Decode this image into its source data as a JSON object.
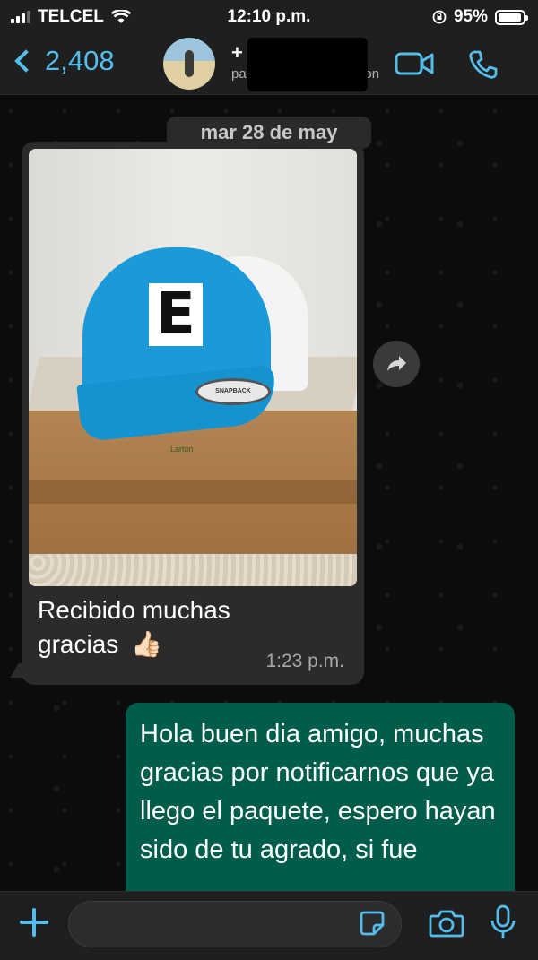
{
  "status_bar": {
    "carrier": "TELCEL",
    "time": "12:10 p.m.",
    "battery_percent": "95%",
    "battery_level": 0.95
  },
  "header": {
    "back_count": "2,408",
    "contact_name": "+",
    "contact_status_left": "pai",
    "contact_status_right": "on"
  },
  "chat": {
    "date_separator": "mar 28 de may",
    "messages": [
      {
        "direction": "incoming",
        "has_image": true,
        "image_letter": "E",
        "image_patch_text": "SNAPBACK",
        "image_box_text": "Larton",
        "text": "Recibido muchas gracias",
        "emoji": "👍🏻",
        "time": "1:23 p.m."
      },
      {
        "direction": "outgoing",
        "text": "Hola buen dia amigo, muchas gracias por notificarnos que ya llego el paquete, espero hayan sido de tu agrado, si fue"
      }
    ]
  },
  "input": {
    "placeholder": "",
    "value": ""
  },
  "colors": {
    "accent": "#53bdeb",
    "incoming_bubble": "#2b2b2b",
    "outgoing_bubble": "#005c4b",
    "bar_bg": "#1f1f1f"
  }
}
